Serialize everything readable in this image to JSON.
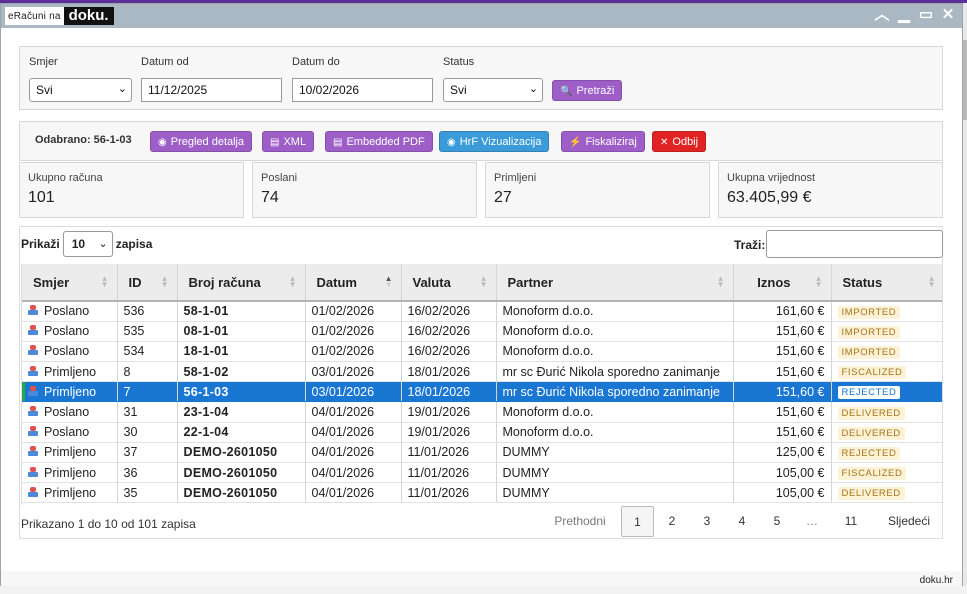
{
  "window": {
    "logo_prefix": "eRačuni na",
    "logo_brand": "doku."
  },
  "filters": {
    "direction_label": "Smjer",
    "direction_value": "Svi",
    "date_from_label": "Datum od",
    "date_from_value": "11/12/2025",
    "date_to_label": "Datum do",
    "date_to_value": "10/02/2026",
    "status_label": "Status",
    "status_value": "Svi",
    "search_button": "Pretraži"
  },
  "actions": {
    "selected_text": "Odabrano: 56-1-03",
    "details": "Pregled detalja",
    "xml": "XML",
    "pdf": "Embedded PDF",
    "hrf": "HrF Vizualizacija",
    "fiscalize": "Fiskaliziraj",
    "reject": "Odbij"
  },
  "stats": [
    {
      "label": "Ukupno računa",
      "value": "101"
    },
    {
      "label": "Poslani",
      "value": "74"
    },
    {
      "label": "Primljeni",
      "value": "27"
    },
    {
      "label": "Ukupna vrijednost",
      "value": "63.405,99 €"
    }
  ],
  "table_controls": {
    "show_label": "Prikaži",
    "show_value": "10",
    "entries_label": "zapisa",
    "search_label": "Traži:"
  },
  "table": {
    "columns": [
      "Smjer",
      "ID",
      "Broj računa",
      "Datum",
      "Valuta",
      "Partner",
      "Iznos",
      "Status"
    ],
    "rows": [
      {
        "dir": "Poslano",
        "id": "536",
        "num": "58-1-01",
        "date": "01/02/2026",
        "due": "16/02/2026",
        "partner": "Monoform d.o.o.",
        "amount": "161,60 €",
        "status": "IMPORTED"
      },
      {
        "dir": "Poslano",
        "id": "535",
        "num": "08-1-01",
        "date": "01/02/2026",
        "due": "16/02/2026",
        "partner": "Monoform d.o.o.",
        "amount": "151,60 €",
        "status": "IMPORTED"
      },
      {
        "dir": "Poslano",
        "id": "534",
        "num": "18-1-01",
        "date": "01/02/2026",
        "due": "16/02/2026",
        "partner": "Monoform d.o.o.",
        "amount": "151,60 €",
        "status": "IMPORTED"
      },
      {
        "dir": "Primljeno",
        "id": "8",
        "num": "58-1-02",
        "date": "03/01/2026",
        "due": "18/01/2026",
        "partner": "mr sc Đurić Nikola sporedno zanimanje",
        "amount": "151,60 €",
        "status": "FISCALIZED"
      },
      {
        "dir": "Primljeno",
        "id": "7",
        "num": "56-1-03",
        "date": "03/01/2026",
        "due": "18/01/2026",
        "partner": "mr sc Đurić Nikola sporedno zanimanje",
        "amount": "151,60 €",
        "status": "REJECTED"
      },
      {
        "dir": "Poslano",
        "id": "31",
        "num": "23-1-04",
        "date": "04/01/2026",
        "due": "19/01/2026",
        "partner": "Monoform d.o.o.",
        "amount": "151,60 €",
        "status": "DELIVERED"
      },
      {
        "dir": "Poslano",
        "id": "30",
        "num": "22-1-04",
        "date": "04/01/2026",
        "due": "19/01/2026",
        "partner": "Monoform d.o.o.",
        "amount": "151,60 €",
        "status": "DELIVERED"
      },
      {
        "dir": "Primljeno",
        "id": "37",
        "num": "DEMO-2601050",
        "date": "04/01/2026",
        "due": "11/01/2026",
        "partner": "DUMMY",
        "amount": "125,00 €",
        "status": "REJECTED"
      },
      {
        "dir": "Primljeno",
        "id": "36",
        "num": "DEMO-2601050",
        "date": "04/01/2026",
        "due": "11/01/2026",
        "partner": "DUMMY",
        "amount": "105,00 €",
        "status": "FISCALIZED"
      },
      {
        "dir": "Primljeno",
        "id": "35",
        "num": "DEMO-2601050",
        "date": "04/01/2026",
        "due": "11/01/2026",
        "partner": "DUMMY",
        "amount": "105,00 €",
        "status": "DELIVERED"
      }
    ],
    "selected_index": 4
  },
  "pagination": {
    "info": "Prikazano 1 do 10 od 101 zapisa",
    "prev": "Prethodni",
    "pages": [
      "1",
      "2",
      "3",
      "4",
      "5",
      "…",
      "11"
    ],
    "current": "1",
    "next": "Sljedeći"
  },
  "footer": {
    "brand": "doku.hr"
  },
  "colors": {
    "purple_button": "#9d5fc7",
    "blue_button": "#3a9bd8",
    "red_button": "#e02424",
    "selected_row": "#1976d2",
    "titlebar": "#a9b8c2"
  }
}
